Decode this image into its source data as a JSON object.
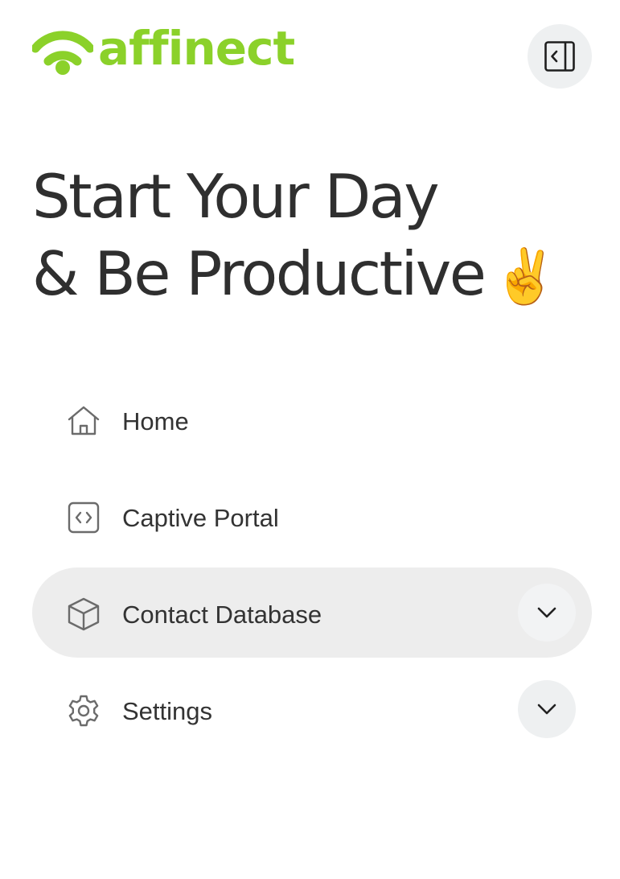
{
  "brand": {
    "name": "affinect",
    "color": "#8bd12a"
  },
  "header": {
    "collapse_icon": "sidebar-collapse-icon"
  },
  "greeting": {
    "line1": "Start Your Day",
    "line2": "& Be Productive",
    "emoji": "✌️"
  },
  "nav": {
    "items": [
      {
        "label": "Home",
        "icon": "home-icon",
        "active": false,
        "expandable": false
      },
      {
        "label": "Captive Portal",
        "icon": "code-icon",
        "active": false,
        "expandable": false
      },
      {
        "label": "Contact Database",
        "icon": "box-icon",
        "active": true,
        "expandable": true
      },
      {
        "label": "Settings",
        "icon": "gear-icon",
        "active": false,
        "expandable": true
      }
    ]
  },
  "colors": {
    "active_bg": "#ededed",
    "text": "#2f2f2f",
    "button_bg": "#eef0f1"
  }
}
